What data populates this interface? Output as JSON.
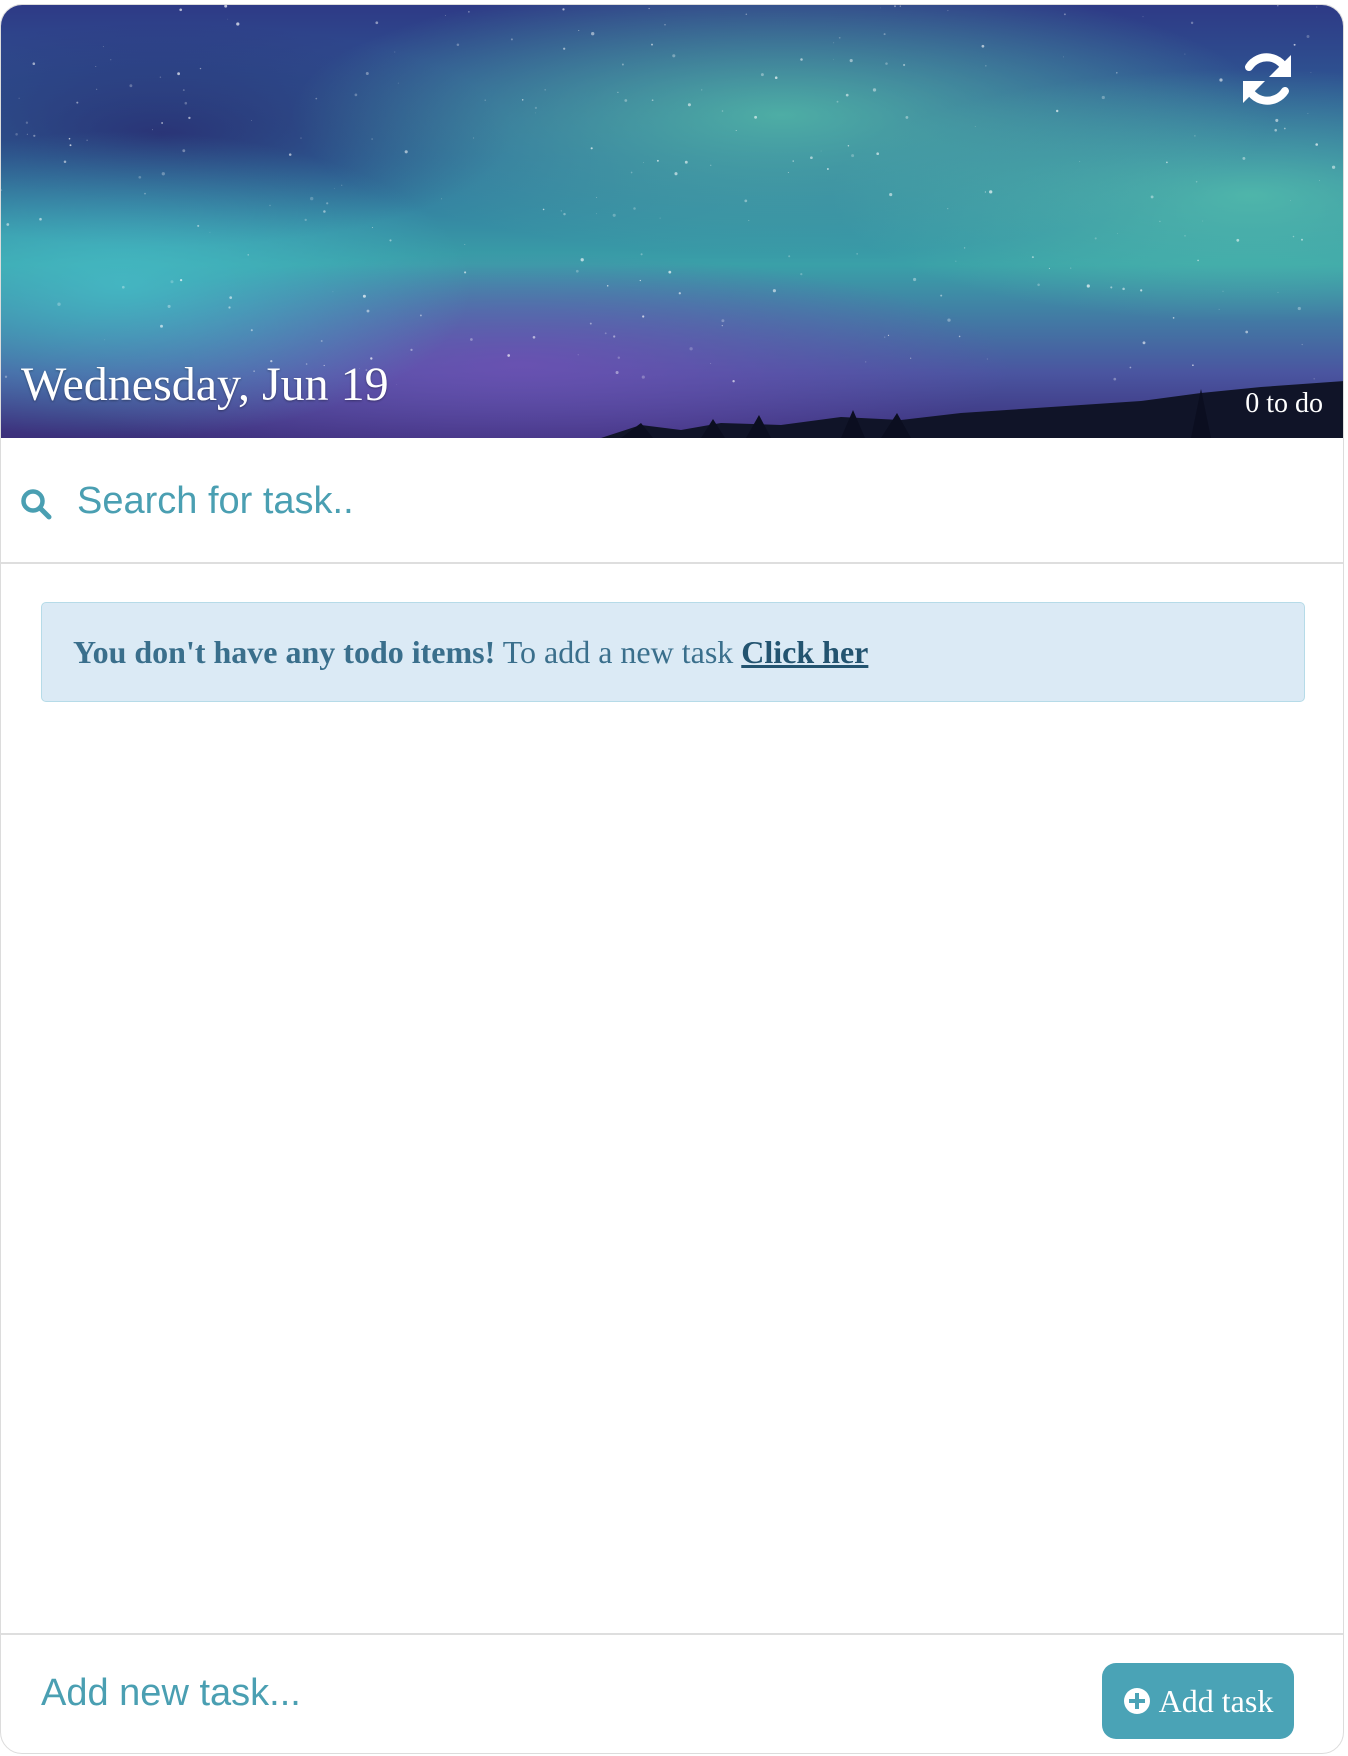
{
  "header": {
    "date": "Wednesday, Jun 19",
    "todo_count": "0 to do"
  },
  "search": {
    "placeholder": "Search for task.."
  },
  "alert": {
    "bold_text": "You don't have any todo items!",
    "text": " To add a new task ",
    "link_text": "Click her"
  },
  "footer": {
    "new_task_placeholder": "Add new task...",
    "add_button_label": "Add task"
  },
  "colors": {
    "accent": "#4aa3b6",
    "alert_bg": "#dbeaf5",
    "alert_text": "#3a6f8c"
  },
  "icons": {
    "refresh": "refresh-icon",
    "search": "search-icon",
    "add": "plus-circle-icon"
  }
}
